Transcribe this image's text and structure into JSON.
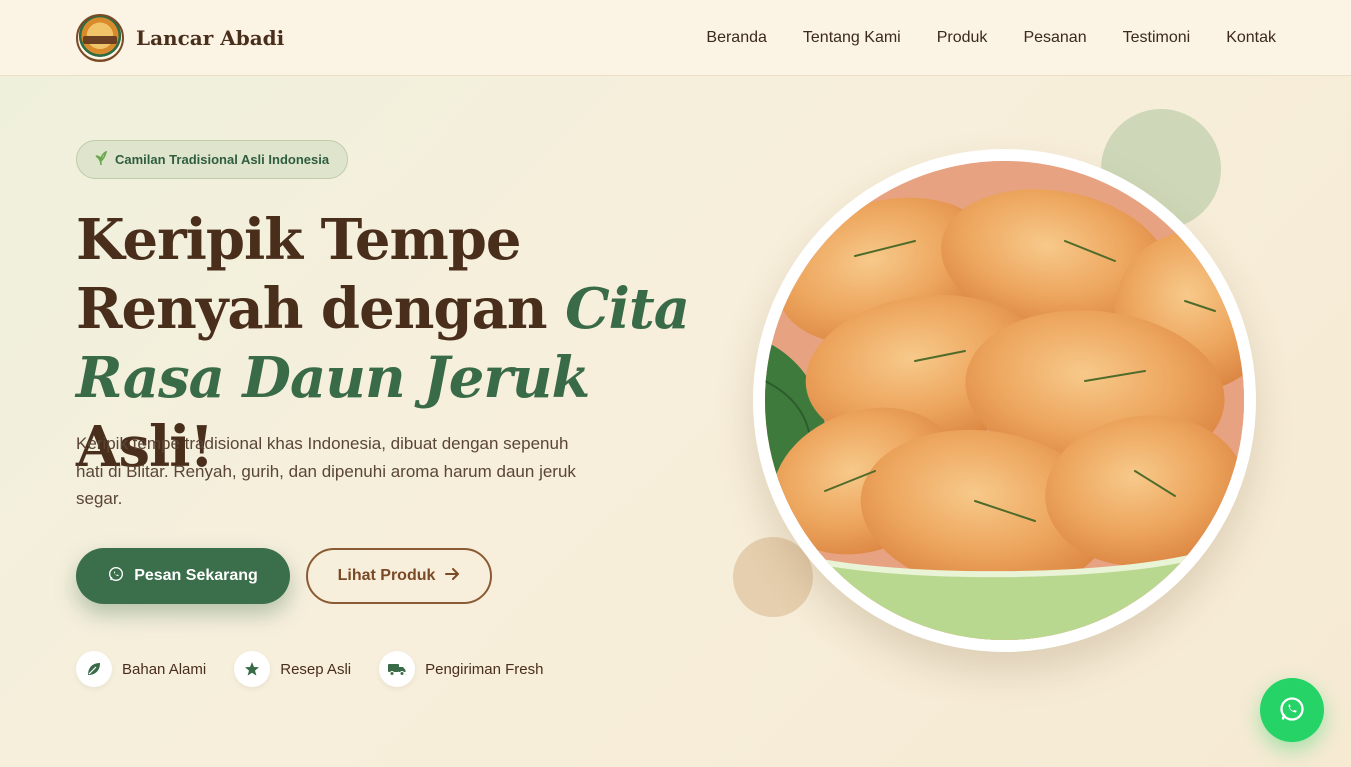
{
  "brand": {
    "name": "Lancar Abadi",
    "logo_text": "LANCAR ABADI"
  },
  "nav": {
    "items": [
      "Beranda",
      "Tentang Kami",
      "Produk",
      "Pesanan",
      "Testimoni",
      "Kontak"
    ]
  },
  "hero": {
    "badge": "Camilan Tradisional Asli Indonesia",
    "headline_part1": "Keripik Tempe Renyah dengan ",
    "headline_accent": "Cita Rasa Daun Jeruk",
    "headline_part2": " Asli!",
    "description": "Keripik tempe tradisional khas Indonesia, dibuat dengan sepenuh hati di Blitar. Renyah, gurih, dan dipenuhi aroma harum daun jeruk segar.",
    "primary_button": "Pesan Sekarang",
    "secondary_button": "Lihat Produk",
    "features": [
      {
        "label": "Bahan Alami",
        "icon": "leaf-icon"
      },
      {
        "label": "Resep Asli",
        "icon": "star-icon"
      },
      {
        "label": "Pengiriman Fresh",
        "icon": "truck-icon"
      }
    ]
  },
  "colors": {
    "primary_green": "#3b6e4b",
    "brown": "#4a2e1c",
    "whatsapp": "#25d366",
    "background": "#f7efdc"
  }
}
